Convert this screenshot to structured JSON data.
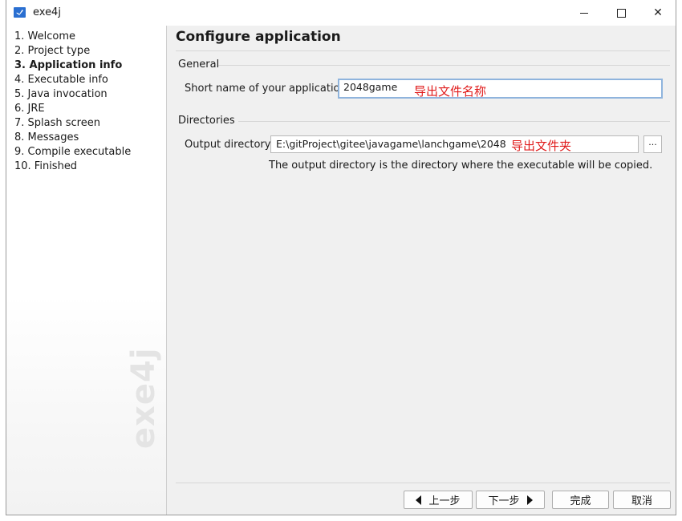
{
  "window": {
    "title": "exe4j"
  },
  "sidebar": {
    "steps": [
      {
        "label": "1. Welcome"
      },
      {
        "label": "2. Project type"
      },
      {
        "label": "3. Application info"
      },
      {
        "label": "4. Executable info"
      },
      {
        "label": "5. Java invocation"
      },
      {
        "label": "6. JRE"
      },
      {
        "label": "7. Splash screen"
      },
      {
        "label": "8. Messages"
      },
      {
        "label": "9. Compile executable"
      },
      {
        "label": "10. Finished"
      }
    ],
    "active_step": "3. Application info",
    "watermark": "exe4j"
  },
  "main": {
    "heading": "Configure application",
    "general": {
      "section_label": "General",
      "short_name_label": "Short name of your application:",
      "short_name_value": "2048game",
      "annotation": "导出文件名称"
    },
    "directories": {
      "section_label": "Directories",
      "output_label": "Output directory:",
      "output_value": "E:\\gitProject\\gitee\\javagame\\lanchgame\\2048",
      "annotation": "导出文件夹",
      "browse_label": "...",
      "help_text": "The output directory is the directory where the executable will be copied."
    }
  },
  "footer": {
    "back_label": "上一步",
    "next_label": "下一步",
    "finish_label": "完成",
    "cancel_label": "取消"
  },
  "colors": {
    "annotation": "#e01b1b",
    "focus_border": "#8fb4dd",
    "app_icon": "#2a6fd1"
  }
}
